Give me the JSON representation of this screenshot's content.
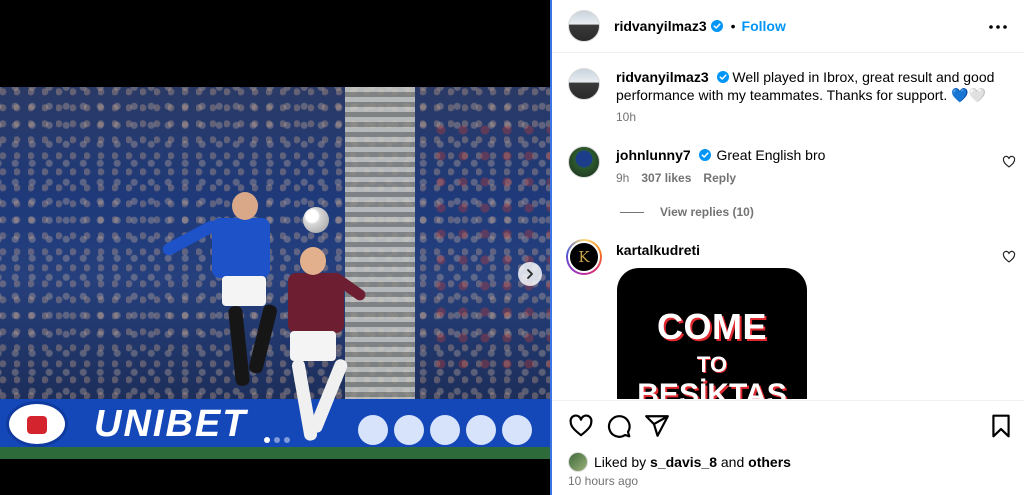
{
  "post": {
    "author": "ridvanyilmaz3",
    "dot": "•",
    "follow_label": "Follow",
    "caption": "Well played in Ibrox, great result and good performance with my teammates. Thanks for support. 💙🤍",
    "caption_age": "10h"
  },
  "media": {
    "hoarding_text": "UNIBET",
    "carousel_dots": 3,
    "active_dot": 1
  },
  "comments": [
    {
      "user": "johnlunny7",
      "verified": true,
      "text": "Great English bro",
      "age": "9h",
      "likes": "307 likes",
      "reply_label": "Reply",
      "view_replies": "View replies (10)"
    },
    {
      "user": "kartalkudreti",
      "verified": false,
      "avatar_letter": "K",
      "sticker_lines": [
        "COME",
        "TO",
        "BESİKTAS"
      ]
    }
  ],
  "footer": {
    "liked_prefix": "Liked by",
    "liked_user": "s_davis_8",
    "liked_and": "and",
    "liked_others": "others",
    "timestamp": "10 hours ago"
  },
  "colors": {
    "accent": "#0095f6",
    "verified": "#0095f6",
    "secondary_text": "#737373",
    "panel_border": "#3b74e4"
  },
  "icons": [
    "more-options-icon",
    "heart-icon",
    "comment-icon",
    "share-icon",
    "bookmark-icon",
    "verified-badge-icon",
    "chevron-right-icon"
  ]
}
